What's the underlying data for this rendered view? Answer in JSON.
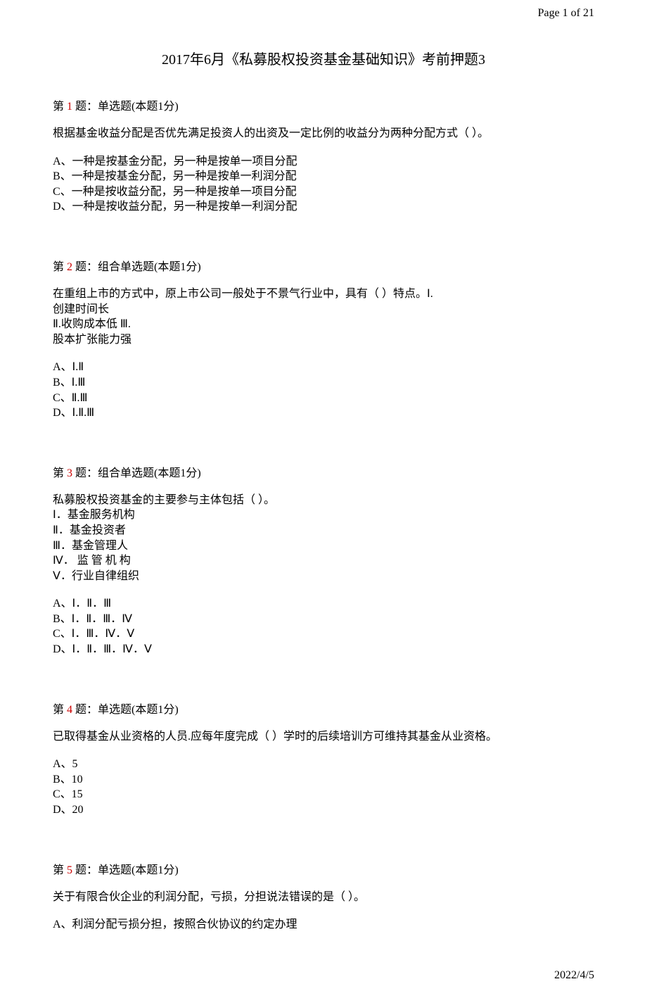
{
  "header": {
    "pageLabel": "Page 1 of 21"
  },
  "title": "2017年6月《私募股权投资基金基础知识》考前押题3",
  "questions": [
    {
      "prefix": "第 ",
      "num": "1",
      "suffix": " 题：单选题(本题1分)",
      "textLines": [
        "根据基金收益分配是否优先满足投资人的出资及一定比例的收益分为两种分配方式（ ）。"
      ],
      "options": [
        "A、一种是按基金分配，另一种是按单一项目分配",
        "B、一种是按基金分配，另一种是按单一利润分配",
        "C、一种是按收益分配，另一种是按单一项目分配",
        "D、一种是按收益分配，另一种是按单一利润分配"
      ]
    },
    {
      "prefix": "第 ",
      "num": "2",
      "suffix": " 题：组合单选题(本题1分)",
      "textLines": [
        "在重组上市的方式中，原上市公司一般处于不景气行业中，具有（  ）特点。Ⅰ.",
        "创建时间长",
        "Ⅱ.收购成本低   Ⅲ.",
        "股本扩张能力强"
      ],
      "options": [
        "A、Ⅰ.Ⅱ",
        "B、Ⅰ.Ⅲ",
        "C、Ⅱ.Ⅲ",
        "D、Ⅰ.Ⅱ.Ⅲ"
      ]
    },
    {
      "prefix": "第 ",
      "num": "3",
      "suffix": " 题：组合单选题(本题1分)",
      "textLines": [
        "私募股权投资基金的主要参与主体包括（  ）。",
        "Ⅰ．基金服务机构",
        "Ⅱ．基金投资者",
        "Ⅲ．基金管理人",
        "Ⅳ． 监 管 机 构",
        "Ⅴ．行业自律组织"
      ],
      "options": [
        "A、Ⅰ．Ⅱ．Ⅲ",
        "B、Ⅰ．Ⅱ．Ⅲ．Ⅳ",
        "C、Ⅰ．Ⅲ．Ⅳ．Ⅴ",
        "D、Ⅰ．Ⅱ．Ⅲ．Ⅳ．Ⅴ"
      ]
    },
    {
      "prefix": "第 ",
      "num": "4",
      "suffix": " 题：单选题(本题1分)",
      "textLines": [
        "已取得基金从业资格的人员.应每年度完成（ ）学时的后续培训方可维持其基金从业资格。"
      ],
      "options": [
        "A、5",
        "B、10",
        "C、15",
        "D、20"
      ]
    },
    {
      "prefix": "第 ",
      "num": "5",
      "suffix": " 题：单选题(本题1分)",
      "textLines": [
        "关于有限合伙企业的利润分配，亏损，分担说法错误的是（ ）。"
      ],
      "options": [
        "A、利润分配亏损分担，按照合伙协议的约定办理"
      ]
    }
  ],
  "footer": {
    "date": "2022/4/5"
  }
}
